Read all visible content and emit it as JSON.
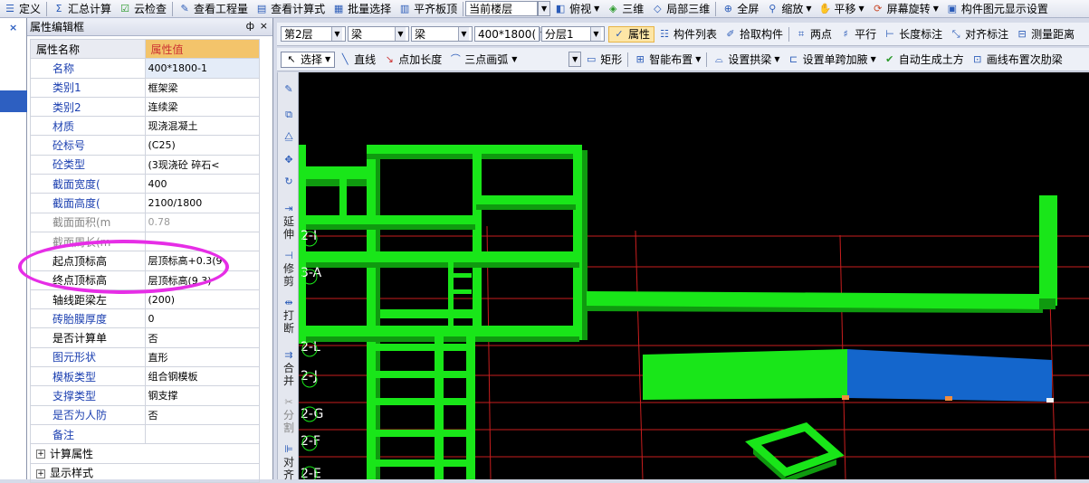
{
  "top_toolbar": {
    "define": "定义",
    "summary_calc": "汇总计算",
    "cloud_check": "云检查",
    "view_quantity": "查看工程量",
    "view_formula": "查看计算式",
    "batch_select": "批量选择",
    "flush_slab_top": "平齐板顶",
    "current_floor": "当前楼层",
    "top_view": "俯视",
    "three_d": "三维",
    "local_3d": "局部三维",
    "full_screen": "全屏",
    "zoom": "缩放",
    "pan": "平移",
    "screen_rotate": "屏幕旋转",
    "component_display": "构件图元显示设置"
  },
  "property_panel": {
    "title": "属性编辑框",
    "pin_glyph": "ф",
    "close_glyph": "×",
    "col_name": "属性名称",
    "col_value": "属性值",
    "rows": [
      {
        "name": "名称",
        "value": "400*1800-1"
      },
      {
        "name": "类别1",
        "value": "框架梁"
      },
      {
        "name": "类别2",
        "value": "连续梁"
      },
      {
        "name": "材质",
        "value": "现浇混凝土"
      },
      {
        "name": "砼标号",
        "value": "(C25)"
      },
      {
        "name": "砼类型",
        "value": "(3现浇砼 碎石<"
      },
      {
        "name": "截面宽度(",
        "value": "400"
      },
      {
        "name": "截面高度(",
        "value": "2100/1800"
      },
      {
        "name": "截面面积(m",
        "value": "0.78"
      },
      {
        "name": "截面周长(m",
        "value": ""
      },
      {
        "name": "起点顶标高",
        "value": "层顶标高+0.3(9"
      },
      {
        "name": "终点顶标高",
        "value": "层顶标高(9.3)"
      },
      {
        "name": "轴线距梁左",
        "value": "(200)"
      },
      {
        "name": "砖胎膜厚度",
        "value": "0"
      },
      {
        "name": "是否计算单",
        "value": "否"
      },
      {
        "name": "图元形状",
        "value": "直形"
      },
      {
        "name": "模板类型",
        "value": "组合钢模板"
      },
      {
        "name": "支撑类型",
        "value": "钢支撑"
      },
      {
        "name": "是否为人防",
        "value": "否"
      },
      {
        "name": "备注",
        "value": ""
      }
    ],
    "groups": [
      "计算属性",
      "显示样式"
    ]
  },
  "toolbar2": {
    "floor": "第2层",
    "type1": "梁",
    "type2": "梁",
    "component": "400*1800(",
    "layer": "分层1",
    "properties": "属性",
    "component_list": "构件列表",
    "pick_component": "拾取构件",
    "two_points": "两点",
    "parallel": "平行",
    "length_dim": "长度标注",
    "align_dim": "对齐标注",
    "measure_dist": "测量距离"
  },
  "toolbar3": {
    "select": "选择",
    "line": "直线",
    "point_add_length": "点加长度",
    "three_point_arc": "三点画弧",
    "rectangle": "矩形",
    "smart_layout": "智能布置",
    "set_arch_beam": "设置拱梁",
    "set_span_haunch": "设置单跨加腋",
    "auto_earthwork": "自动生成土方",
    "draw_secondary_rebar": "画线布置次肋梁"
  },
  "vstrip": {
    "extend": "延伸",
    "trim": "修剪",
    "break": "打断",
    "merge": "合并",
    "split": "分割",
    "align": "对齐"
  },
  "axis_labels": [
    "2-I",
    "3-A",
    "2-L",
    "2-J",
    "2-G",
    "2-F",
    "2-E"
  ],
  "colors": {
    "beam_green": "#19e619",
    "beam_dark_green": "#0f9a0f",
    "beam_selected_blue": "#1466cc",
    "grid_red": "#c81e1e",
    "highlight_ellipse": "#e62ee6"
  }
}
